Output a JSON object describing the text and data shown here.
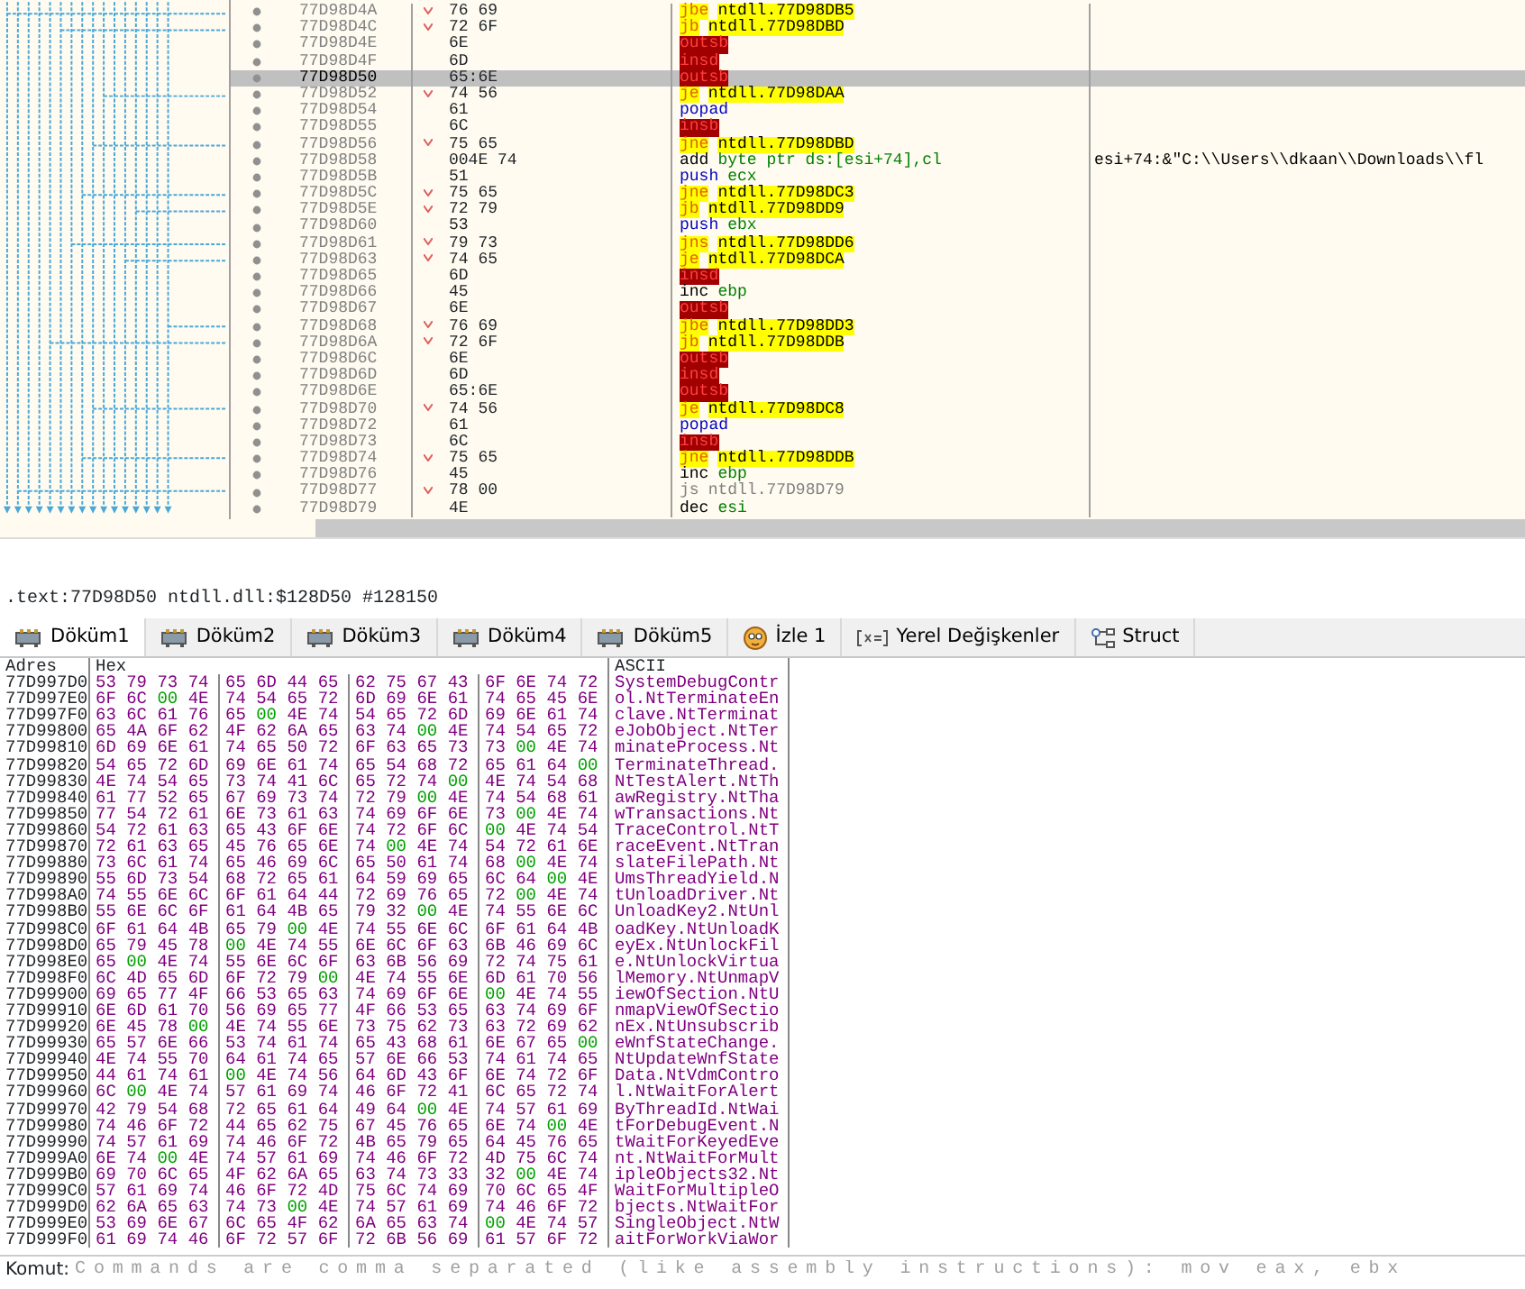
{
  "disassembly": {
    "rows": [
      {
        "address": "77D98D4A",
        "bytes": "76 69",
        "mnemonic": "jbe",
        "operands": "ntdll.77D98DB5",
        "kind": "jump",
        "selected": false
      },
      {
        "address": "77D98D4C",
        "bytes": "72 6F",
        "mnemonic": "jb",
        "operands": "ntdll.77D98DBD",
        "kind": "jump",
        "selected": false
      },
      {
        "address": "77D98D4E",
        "bytes": "6E",
        "mnemonic": "outsb",
        "operands": "",
        "kind": "bad",
        "selected": false
      },
      {
        "address": "77D98D4F",
        "bytes": "6D",
        "mnemonic": "insd",
        "operands": "",
        "kind": "bad",
        "selected": false
      },
      {
        "address": "77D98D50",
        "bytes": "65:6E",
        "mnemonic": "outsb",
        "operands": "",
        "kind": "bad",
        "selected": true
      },
      {
        "address": "77D98D52",
        "bytes": "74 56",
        "mnemonic": "je",
        "operands": "ntdll.77D98DAA",
        "kind": "jump",
        "selected": false
      },
      {
        "address": "77D98D54",
        "bytes": "61",
        "mnemonic": "popad",
        "operands": "",
        "kind": "stack",
        "selected": false
      },
      {
        "address": "77D98D55",
        "bytes": "6C",
        "mnemonic": "insb",
        "operands": "",
        "kind": "bad",
        "selected": false
      },
      {
        "address": "77D98D56",
        "bytes": "75 65",
        "mnemonic": "jne",
        "operands": "ntdll.77D98DBD",
        "kind": "jump",
        "selected": false
      },
      {
        "address": "77D98D58",
        "bytes": "004E 74",
        "mnemonic": "add",
        "operands": "byte ptr ds:[esi+74],cl",
        "kind": "arith",
        "selected": false,
        "comment": "esi+74:&\"C:\\\\Users\\\\dkaan\\\\Downloads\\\\fl"
      },
      {
        "address": "77D98D5B",
        "bytes": "51",
        "mnemonic": "push",
        "operands": "ecx",
        "kind": "stack",
        "selected": false
      },
      {
        "address": "77D98D5C",
        "bytes": "75 65",
        "mnemonic": "jne",
        "operands": "ntdll.77D98DC3",
        "kind": "jump",
        "selected": false
      },
      {
        "address": "77D98D5E",
        "bytes": "72 79",
        "mnemonic": "jb",
        "operands": "ntdll.77D98DD9",
        "kind": "jump",
        "selected": false
      },
      {
        "address": "77D98D60",
        "bytes": "53",
        "mnemonic": "push",
        "operands": "ebx",
        "kind": "stack",
        "selected": false
      },
      {
        "address": "77D98D61",
        "bytes": "79 73",
        "mnemonic": "jns",
        "operands": "ntdll.77D98DD6",
        "kind": "jump",
        "selected": false
      },
      {
        "address": "77D98D63",
        "bytes": "74 65",
        "mnemonic": "je",
        "operands": "ntdll.77D98DCA",
        "kind": "jump",
        "selected": false
      },
      {
        "address": "77D98D65",
        "bytes": "6D",
        "mnemonic": "insd",
        "operands": "",
        "kind": "bad",
        "selected": false
      },
      {
        "address": "77D98D66",
        "bytes": "45",
        "mnemonic": "inc",
        "operands": "ebp",
        "kind": "arith",
        "selected": false
      },
      {
        "address": "77D98D67",
        "bytes": "6E",
        "mnemonic": "outsb",
        "operands": "",
        "kind": "bad",
        "selected": false
      },
      {
        "address": "77D98D68",
        "bytes": "76 69",
        "mnemonic": "jbe",
        "operands": "ntdll.77D98DD3",
        "kind": "jump",
        "selected": false
      },
      {
        "address": "77D98D6A",
        "bytes": "72 6F",
        "mnemonic": "jb",
        "operands": "ntdll.77D98DDB",
        "kind": "jump",
        "selected": false
      },
      {
        "address": "77D98D6C",
        "bytes": "6E",
        "mnemonic": "outsb",
        "operands": "",
        "kind": "bad",
        "selected": false
      },
      {
        "address": "77D98D6D",
        "bytes": "6D",
        "mnemonic": "insd",
        "operands": "",
        "kind": "bad",
        "selected": false
      },
      {
        "address": "77D98D6E",
        "bytes": "65:6E",
        "mnemonic": "outsb",
        "operands": "",
        "kind": "bad",
        "selected": false
      },
      {
        "address": "77D98D70",
        "bytes": "74 56",
        "mnemonic": "je",
        "operands": "ntdll.77D98DC8",
        "kind": "jump",
        "selected": false
      },
      {
        "address": "77D98D72",
        "bytes": "61",
        "mnemonic": "popad",
        "operands": "",
        "kind": "stack",
        "selected": false
      },
      {
        "address": "77D98D73",
        "bytes": "6C",
        "mnemonic": "insb",
        "operands": "",
        "kind": "bad",
        "selected": false
      },
      {
        "address": "77D98D74",
        "bytes": "75 65",
        "mnemonic": "jne",
        "operands": "ntdll.77D98DDB",
        "kind": "jump",
        "selected": false
      },
      {
        "address": "77D98D76",
        "bytes": "45",
        "mnemonic": "inc",
        "operands": "ebp",
        "kind": "arith",
        "selected": false
      },
      {
        "address": "77D98D77",
        "bytes": "78 00",
        "mnemonic": "js",
        "operands": "ntdll.77D98D79",
        "kind": "jump-not-taken",
        "selected": false
      },
      {
        "address": "77D98D79",
        "bytes": "4E",
        "mnemonic": "dec",
        "operands": "esi",
        "kind": "arith",
        "selected": false
      }
    ]
  },
  "info_line": ".text:77D98D50 ntdll.dll:$128D50 #128150",
  "tabs": [
    {
      "label": "Döküm1",
      "kind": "dump",
      "selected": true
    },
    {
      "label": "Döküm2",
      "kind": "dump",
      "selected": false
    },
    {
      "label": "Döküm3",
      "kind": "dump",
      "selected": false
    },
    {
      "label": "Döküm4",
      "kind": "dump",
      "selected": false
    },
    {
      "label": "Döküm5",
      "kind": "dump",
      "selected": false
    },
    {
      "label": "İzle 1",
      "kind": "watch",
      "selected": false
    },
    {
      "label": "Yerel Değişkenler",
      "kind": "locals",
      "selected": false
    },
    {
      "label": "Struct",
      "kind": "struct",
      "selected": false
    }
  ],
  "dump": {
    "columns": [
      "Adres",
      "Hex",
      "ASCII"
    ],
    "rows": [
      {
        "address": "77D997D0",
        "hex": [
          "53 79 73 74",
          "65 6D 44 65",
          "62 75 67 43",
          "6F 6E 74 72"
        ],
        "ascii": "SystemDebugContr"
      },
      {
        "address": "77D997E0",
        "hex": [
          "6F 6C 00 4E",
          "74 54 65 72",
          "6D 69 6E 61",
          "74 65 45 6E"
        ],
        "ascii": "ol.NtTerminateEn"
      },
      {
        "address": "77D997F0",
        "hex": [
          "63 6C 61 76",
          "65 00 4E 74",
          "54 65 72 6D",
          "69 6E 61 74"
        ],
        "ascii": "clave.NtTerminat"
      },
      {
        "address": "77D99800",
        "hex": [
          "65 4A 6F 62",
          "4F 62 6A 65",
          "63 74 00 4E",
          "74 54 65 72"
        ],
        "ascii": "eJobObject.NtTer"
      },
      {
        "address": "77D99810",
        "hex": [
          "6D 69 6E 61",
          "74 65 50 72",
          "6F 63 65 73",
          "73 00 4E 74"
        ],
        "ascii": "minateProcess.Nt"
      },
      {
        "address": "77D99820",
        "hex": [
          "54 65 72 6D",
          "69 6E 61 74",
          "65 54 68 72",
          "65 61 64 00"
        ],
        "ascii": "TerminateThread."
      },
      {
        "address": "77D99830",
        "hex": [
          "4E 74 54 65",
          "73 74 41 6C",
          "65 72 74 00",
          "4E 74 54 68"
        ],
        "ascii": "NtTestAlert.NtTh"
      },
      {
        "address": "77D99840",
        "hex": [
          "61 77 52 65",
          "67 69 73 74",
          "72 79 00 4E",
          "74 54 68 61"
        ],
        "ascii": "awRegistry.NtTha"
      },
      {
        "address": "77D99850",
        "hex": [
          "77 54 72 61",
          "6E 73 61 63",
          "74 69 6F 6E",
          "73 00 4E 74"
        ],
        "ascii": "wTransactions.Nt"
      },
      {
        "address": "77D99860",
        "hex": [
          "54 72 61 63",
          "65 43 6F 6E",
          "74 72 6F 6C",
          "00 4E 74 54"
        ],
        "ascii": "TraceControl.NtT"
      },
      {
        "address": "77D99870",
        "hex": [
          "72 61 63 65",
          "45 76 65 6E",
          "74 00 4E 74",
          "54 72 61 6E"
        ],
        "ascii": "raceEvent.NtTran"
      },
      {
        "address": "77D99880",
        "hex": [
          "73 6C 61 74",
          "65 46 69 6C",
          "65 50 61 74",
          "68 00 4E 74"
        ],
        "ascii": "slateFilePath.Nt"
      },
      {
        "address": "77D99890",
        "hex": [
          "55 6D 73 54",
          "68 72 65 61",
          "64 59 69 65",
          "6C 64 00 4E"
        ],
        "ascii": "UmsThreadYield.N"
      },
      {
        "address": "77D998A0",
        "hex": [
          "74 55 6E 6C",
          "6F 61 64 44",
          "72 69 76 65",
          "72 00 4E 74"
        ],
        "ascii": "tUnloadDriver.Nt"
      },
      {
        "address": "77D998B0",
        "hex": [
          "55 6E 6C 6F",
          "61 64 4B 65",
          "79 32 00 4E",
          "74 55 6E 6C"
        ],
        "ascii": "UnloadKey2.NtUnl"
      },
      {
        "address": "77D998C0",
        "hex": [
          "6F 61 64 4B",
          "65 79 00 4E",
          "74 55 6E 6C",
          "6F 61 64 4B"
        ],
        "ascii": "oadKey.NtUnloadK"
      },
      {
        "address": "77D998D0",
        "hex": [
          "65 79 45 78",
          "00 4E 74 55",
          "6E 6C 6F 63",
          "6B 46 69 6C"
        ],
        "ascii": "eyEx.NtUnlockFil"
      },
      {
        "address": "77D998E0",
        "hex": [
          "65 00 4E 74",
          "55 6E 6C 6F",
          "63 6B 56 69",
          "72 74 75 61"
        ],
        "ascii": "e.NtUnlockVirtua"
      },
      {
        "address": "77D998F0",
        "hex": [
          "6C 4D 65 6D",
          "6F 72 79 00",
          "4E 74 55 6E",
          "6D 61 70 56"
        ],
        "ascii": "lMemory.NtUnmapV"
      },
      {
        "address": "77D99900",
        "hex": [
          "69 65 77 4F",
          "66 53 65 63",
          "74 69 6F 6E",
          "00 4E 74 55"
        ],
        "ascii": "iewOfSection.NtU"
      },
      {
        "address": "77D99910",
        "hex": [
          "6E 6D 61 70",
          "56 69 65 77",
          "4F 66 53 65",
          "63 74 69 6F"
        ],
        "ascii": "nmapViewOfSectio"
      },
      {
        "address": "77D99920",
        "hex": [
          "6E 45 78 00",
          "4E 74 55 6E",
          "73 75 62 73",
          "63 72 69 62"
        ],
        "ascii": "nEx.NtUnsubscrib"
      },
      {
        "address": "77D99930",
        "hex": [
          "65 57 6E 66",
          "53 74 61 74",
          "65 43 68 61",
          "6E 67 65 00"
        ],
        "ascii": "eWnfStateChange."
      },
      {
        "address": "77D99940",
        "hex": [
          "4E 74 55 70",
          "64 61 74 65",
          "57 6E 66 53",
          "74 61 74 65"
        ],
        "ascii": "NtUpdateWnfState"
      },
      {
        "address": "77D99950",
        "hex": [
          "44 61 74 61",
          "00 4E 74 56",
          "64 6D 43 6F",
          "6E 74 72 6F"
        ],
        "ascii": "Data.NtVdmContro"
      },
      {
        "address": "77D99960",
        "hex": [
          "6C 00 4E 74",
          "57 61 69 74",
          "46 6F 72 41",
          "6C 65 72 74"
        ],
        "ascii": "l.NtWaitForAlert"
      },
      {
        "address": "77D99970",
        "hex": [
          "42 79 54 68",
          "72 65 61 64",
          "49 64 00 4E",
          "74 57 61 69"
        ],
        "ascii": "ByThreadId.NtWai"
      },
      {
        "address": "77D99980",
        "hex": [
          "74 46 6F 72",
          "44 65 62 75",
          "67 45 76 65",
          "6E 74 00 4E"
        ],
        "ascii": "tForDebugEvent.N"
      },
      {
        "address": "77D99990",
        "hex": [
          "74 57 61 69",
          "74 46 6F 72",
          "4B 65 79 65",
          "64 45 76 65"
        ],
        "ascii": "tWaitForKeyedEve"
      },
      {
        "address": "77D999A0",
        "hex": [
          "6E 74 00 4E",
          "74 57 61 69",
          "74 46 6F 72",
          "4D 75 6C 74"
        ],
        "ascii": "nt.NtWaitForMult"
      },
      {
        "address": "77D999B0",
        "hex": [
          "69 70 6C 65",
          "4F 62 6A 65",
          "63 74 73 33",
          "32 00 4E 74"
        ],
        "ascii": "ipleObjects32.Nt"
      },
      {
        "address": "77D999C0",
        "hex": [
          "57 61 69 74",
          "46 6F 72 4D",
          "75 6C 74 69",
          "70 6C 65 4F"
        ],
        "ascii": "WaitForMultipleO"
      },
      {
        "address": "77D999D0",
        "hex": [
          "62 6A 65 63",
          "74 73 00 4E",
          "74 57 61 69",
          "74 46 6F 72"
        ],
        "ascii": "bjects.NtWaitFor"
      },
      {
        "address": "77D999E0",
        "hex": [
          "53 69 6E 67",
          "6C 65 4F 62",
          "6A 65 63 74",
          "00 4E 74 57"
        ],
        "ascii": "SingleObject.NtW"
      },
      {
        "address": "77D999F0",
        "hex": [
          "61 69 74 46",
          "6F 72 57 6F",
          "72 6B 56 69",
          "61 57 6F 72"
        ],
        "ascii": "aitForWorkViaWor"
      }
    ]
  },
  "command": {
    "label": "Komut:",
    "placeholder": "Commands are comma separated (like assembly instructions): mov eax, ebx"
  }
}
